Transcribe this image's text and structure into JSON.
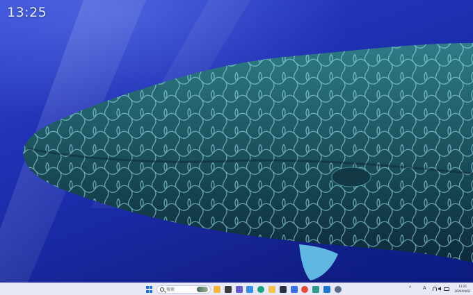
{
  "desktop": {
    "clock_widget": "13:25",
    "wallpaper": "humpback-whale-underwater"
  },
  "taskbar": {
    "search_placeholder": "搜索",
    "pinned_apps": [
      {
        "name": "file-explorer",
        "color": "#f4b73a"
      },
      {
        "name": "task-view",
        "color": "#3a3a3a"
      },
      {
        "name": "teams-chat",
        "color": "#6a5ad0"
      },
      {
        "name": "copilot",
        "color": "#3c8be8"
      },
      {
        "name": "edge-browser",
        "color": "#1ba27a"
      },
      {
        "name": "folder",
        "color": "#f2c34b"
      },
      {
        "name": "terminal",
        "color": "#2a3346"
      },
      {
        "name": "microsoft-store",
        "color": "#3b6ee8"
      },
      {
        "name": "chrome-browser",
        "color": "#e0483a"
      },
      {
        "name": "kite-app",
        "color": "#2d9a8a"
      },
      {
        "name": "mobile-device",
        "color": "#1b74d8"
      },
      {
        "name": "settings",
        "color": "#5a6a8a"
      }
    ],
    "tray": {
      "chevron": "^",
      "language": "A",
      "time": "13:25",
      "date": "2024/04/03"
    }
  }
}
